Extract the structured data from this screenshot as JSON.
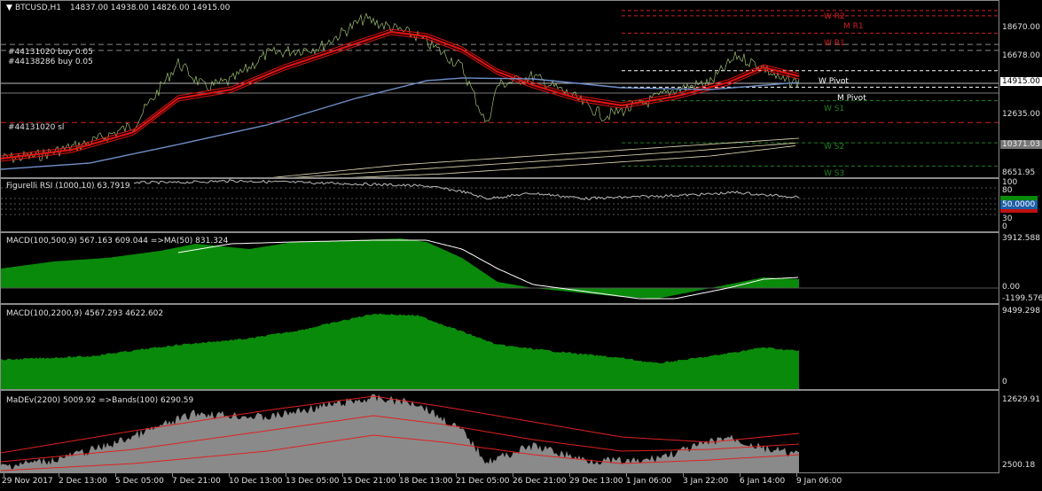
{
  "header": {
    "symbol": "BTCUSD,H1",
    "ohlc": "14837.00 14938.00 14826.00 14915.00"
  },
  "price_pane": {
    "orders": [
      {
        "text": "#44131020 buy 0.05",
        "level": 16900
      },
      {
        "text": "#44138286 buy 0.05",
        "level": 16500
      },
      {
        "text": "#44131020 sl",
        "level": 11700
      }
    ],
    "pivots": [
      {
        "name": "W R2",
        "level": 19150,
        "color": "#d02020"
      },
      {
        "name": "M R1",
        "level": 18800,
        "color": "#d02020"
      },
      {
        "name": "W R1",
        "level": 17650,
        "color": "#d02020"
      },
      {
        "name": "W Pivot",
        "level": 15150,
        "color": "#ffffff"
      },
      {
        "name": "M Pivot",
        "level": 14050,
        "color": "#ffffff"
      },
      {
        "name": "W S1",
        "level": 13150,
        "color": "#208020"
      },
      {
        "name": "W S2",
        "level": 10350,
        "color": "#208020"
      },
      {
        "name": "W S3",
        "level": 8800,
        "color": "#208020"
      }
    ],
    "axis_labels": [
      "18670.00",
      "16678.00",
      "12635.00",
      "8651.95"
    ],
    "current_price": "14915.00",
    "secondary_price": "10371.03"
  },
  "rsi_pane": {
    "title": "Figurelli RSI (1000,10) 63.7919",
    "axis_labels": [
      "100",
      "80",
      "30",
      "0"
    ],
    "value_box": "50.0000"
  },
  "macd1_pane": {
    "title": "MACD(100,500,9) 567.163 609.044  =>MA(50) 831.324",
    "axis_labels": [
      "3912.588",
      "0.00",
      "-1199.576"
    ]
  },
  "macd2_pane": {
    "title": "MACD(100,2200,9) 4567.293 4622.602",
    "axis_labels": [
      "9499.298",
      "0"
    ]
  },
  "madev_pane": {
    "title": "MaDEv(2200) 5009.92  =>Bands(100) 6290.59",
    "axis_labels": [
      "12629.91",
      "2500.18"
    ]
  },
  "x_axis": {
    "labels": [
      "29 Nov 2017",
      "2 Dec 13:00",
      "5 Dec 05:00",
      "7 Dec 21:00",
      "10 Dec 13:00",
      "13 Dec 05:00",
      "15 Dec 21:00",
      "18 Dec 13:00",
      "21 Dec 05:00",
      "26 Dec 21:00",
      "29 Dec 13:00",
      "1 Jan 06:00",
      "3 Jan 22:00",
      "6 Jan 14:00",
      "9 Jan 06:00"
    ]
  },
  "colors": {
    "bull_green": "#0a8a0a",
    "ma_red": "#e01010",
    "ma_blue": "#6f8fc8",
    "price_line": "#9fbf6f",
    "grid": "#3a3a3a"
  }
}
